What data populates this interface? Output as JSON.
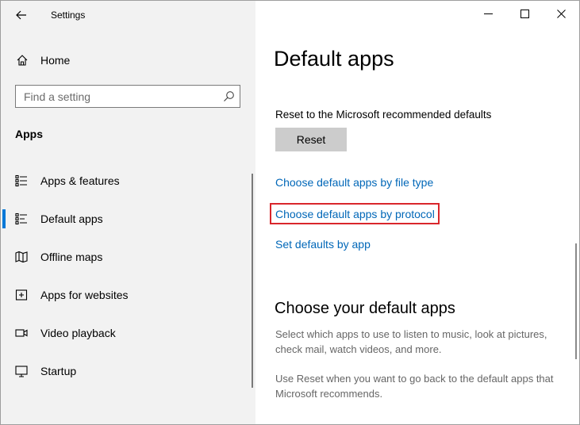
{
  "window": {
    "title": "Settings"
  },
  "sidebar": {
    "home_label": "Home",
    "search": {
      "placeholder": "Find a setting",
      "value": ""
    },
    "section_title": "Apps",
    "items": [
      {
        "label": "Apps & features",
        "icon": "apps-features-icon",
        "selected": false
      },
      {
        "label": "Default apps",
        "icon": "default-apps-icon",
        "selected": true
      },
      {
        "label": "Offline maps",
        "icon": "offline-maps-icon",
        "selected": false
      },
      {
        "label": "Apps for websites",
        "icon": "apps-for-websites-icon",
        "selected": false
      },
      {
        "label": "Video playback",
        "icon": "video-playback-icon",
        "selected": false
      },
      {
        "label": "Startup",
        "icon": "startup-icon",
        "selected": false
      }
    ]
  },
  "main": {
    "title": "Default apps",
    "reset_label": "Reset to the Microsoft recommended defaults",
    "reset_button": "Reset",
    "links": [
      "Choose default apps by file type",
      "Choose default apps by protocol",
      "Set defaults by app"
    ],
    "highlighted_link_index": 1,
    "subtitle": "Choose your default apps",
    "para1": "Select which apps to use to listen to music, look at pictures, check mail, watch videos, and more.",
    "para2": "Use Reset when you want to go back to the default apps that Microsoft recommends."
  },
  "colors": {
    "accent": "#0078d7",
    "link": "#0067b8",
    "highlight_border": "#d9262b",
    "sidebar_bg": "#f2f2f2"
  }
}
